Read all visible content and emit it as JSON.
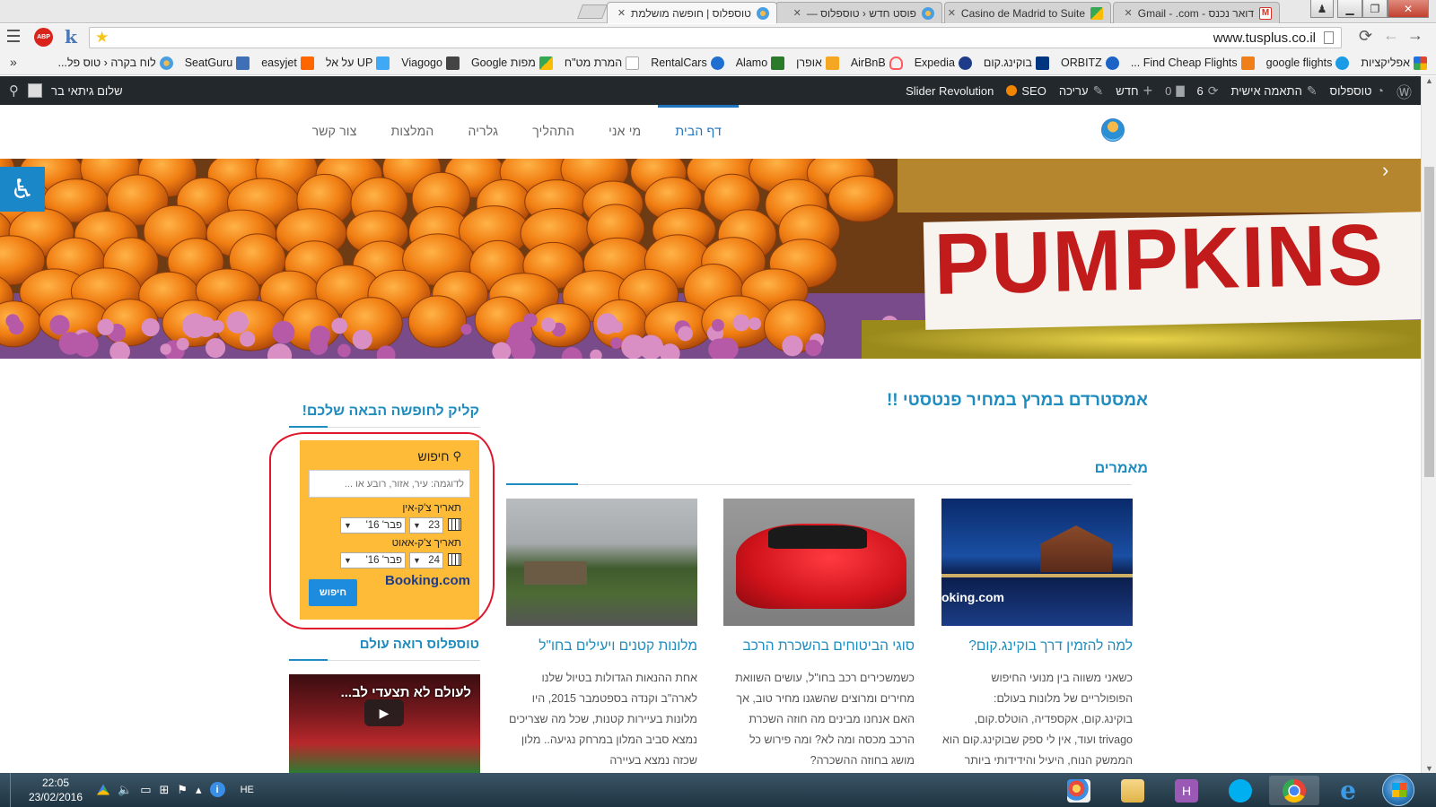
{
  "tabs": [
    {
      "title": "דואר נכנס - Gmail -         .com",
      "favicon_color": "#d93025",
      "active": false
    },
    {
      "title": "Casino de Madrid to Suite",
      "favicon_color": "#34a853",
      "active": false
    },
    {
      "title": "פוסט חדש ‹ טוספלוס — ",
      "favicon_color": "#4a9fe0",
      "active": false
    },
    {
      "title": "טוספלוס | חופשה מושלמת",
      "favicon_color": "#4a9fe0",
      "active": true
    }
  ],
  "toolbar": {
    "url": "www.tusplus.co.il",
    "abp_label": "ABP",
    "k_label": "k"
  },
  "bookmarks": [
    {
      "label": "אפליקציות",
      "color": "#e0452b"
    },
    {
      "label": "google flights",
      "color": "#1a9be6"
    },
    {
      "label": "Find Cheap Flights ...",
      "color": "#f07f1a"
    },
    {
      "label": "ORBITZ",
      "color": "#1b63c6"
    },
    {
      "label": "בוקינג.קום",
      "color": "#003580"
    },
    {
      "label": "Expedia",
      "color": "#1f3c88"
    },
    {
      "label": "AirBnB",
      "color": "#ff5a5f"
    },
    {
      "label": "אופרן",
      "color": "#f5a623"
    },
    {
      "label": "Alamo",
      "color": "#2a7a2a"
    },
    {
      "label": "RentalCars",
      "color": "#1f6fd1"
    },
    {
      "label": "המרת מט\"ח",
      "color": "#aaaaaa"
    },
    {
      "label": "מפות Google",
      "color": "#34a853"
    },
    {
      "label": "Viagogo",
      "color": "#444444"
    },
    {
      "label": "UP על אל",
      "color": "#3fa9f5"
    },
    {
      "label": "easyjet",
      "color": "#ff6600"
    },
    {
      "label": "SeatGuru",
      "color": "#3f6fb6"
    },
    {
      "label": "לוח בקרה ‹ טוס פל...",
      "color": "#4a9fe0"
    }
  ],
  "bookmarks_overflow": "»",
  "adminbar": {
    "right": [
      {
        "icon": "wordpress-icon",
        "glyph": "Ⓦ",
        "label": ""
      },
      {
        "icon": "dashboard-icon",
        "glyph": "◔",
        "label": "טוספלוס"
      },
      {
        "icon": "customize-icon",
        "glyph": "✎",
        "label": "התאמה אישית"
      },
      {
        "icon": "updates-icon",
        "glyph": "⟳",
        "label": "6"
      },
      {
        "icon": "comments-icon",
        "glyph": "▇",
        "label": "0"
      },
      {
        "icon": "new-icon",
        "glyph": "+",
        "label": "חדש"
      },
      {
        "icon": "edit-icon",
        "glyph": "✎",
        "label": "עריכה"
      },
      {
        "icon": "seo-icon",
        "glyph": "●",
        "label": "SEO"
      },
      {
        "icon": "",
        "glyph": "",
        "label": "Slider Revolution"
      }
    ],
    "greeting": "שלום גיתאי בר"
  },
  "nav": [
    {
      "label": "דף הבית",
      "active": true
    },
    {
      "label": "מי אני",
      "active": false
    },
    {
      "label": "התהליך",
      "active": false
    },
    {
      "label": "גלריה",
      "active": false
    },
    {
      "label": "המלצות",
      "active": false
    },
    {
      "label": "צור קשר",
      "active": false
    }
  ],
  "hero": {
    "sign_text": "PUMPKINS"
  },
  "content": {
    "headline": "אמסטרדם במרץ במחיר פנטסטי !!",
    "section_title": "מאמרים",
    "posts": [
      {
        "title": "למה להזמין דרך בוקינג.קום?",
        "excerpt": "כשאני משווה בין מנועי החיפוש הפופולריים של מלונות בעולם: בוקינג.קום, אקספדיה, הוטלס.קום, trivago ועוד, אין לי ספק שבוקינג.קום הוא הממשק הנוח, היעיל והידידותי ביותר",
        "image_caption": "oking.com"
      },
      {
        "title": "סוגי הביטוחים בהשכרת הרכב",
        "excerpt": "כשמשכירים רכב בחו\"ל, עושים השוואת מחירים ומרוצים שהשגנו מחיר טוב, אך האם אנחנו מבינים מה חוזה השכרת הרכב מכסה ומה לא? ומה פירוש כל מושג בחוזה ההשכרה?"
      },
      {
        "title": "מלונות קטנים ויעילים בחו\"ל",
        "excerpt": "אחת ההנאות הגדולות בטיול שלנו לארה\"ב וקנדה בספטמבר 2015, היו מלונות בעיירות קטנות, שכל מה שצריכים נמצא סביב המלון במרחק נגיעה.. מלון שכזה נמצא בעיירה"
      }
    ]
  },
  "sidebar": {
    "title1": "קליק לחופשה הבאה שלכם!",
    "title2": "טוספלוס רואה עולם",
    "booking": {
      "search_title": "חיפוש",
      "placeholder": "לדוגמה: עיר, אזור, רובע או ...",
      "checkin_label": "תאריך צ'ק-אין",
      "checkin_day": "23",
      "checkin_month": "פבר' 16'",
      "checkout_label": "תאריך צ'ק-אאוט",
      "checkout_day": "24",
      "checkout_month": "פבר' 16'",
      "search_button": "חיפוש",
      "brand": "Booking.com"
    },
    "video_title": "לעולם לא תצעדי לב..."
  },
  "taskbar": {
    "language": "HE",
    "time": "22:05",
    "date": "23/02/2016"
  },
  "colors": {
    "accent": "#1e8cbe",
    "admin_bar": "#23282d",
    "booking_bg": "#febb38",
    "booking_button": "#1e8cde",
    "highlight_circle": "#e0162b"
  }
}
